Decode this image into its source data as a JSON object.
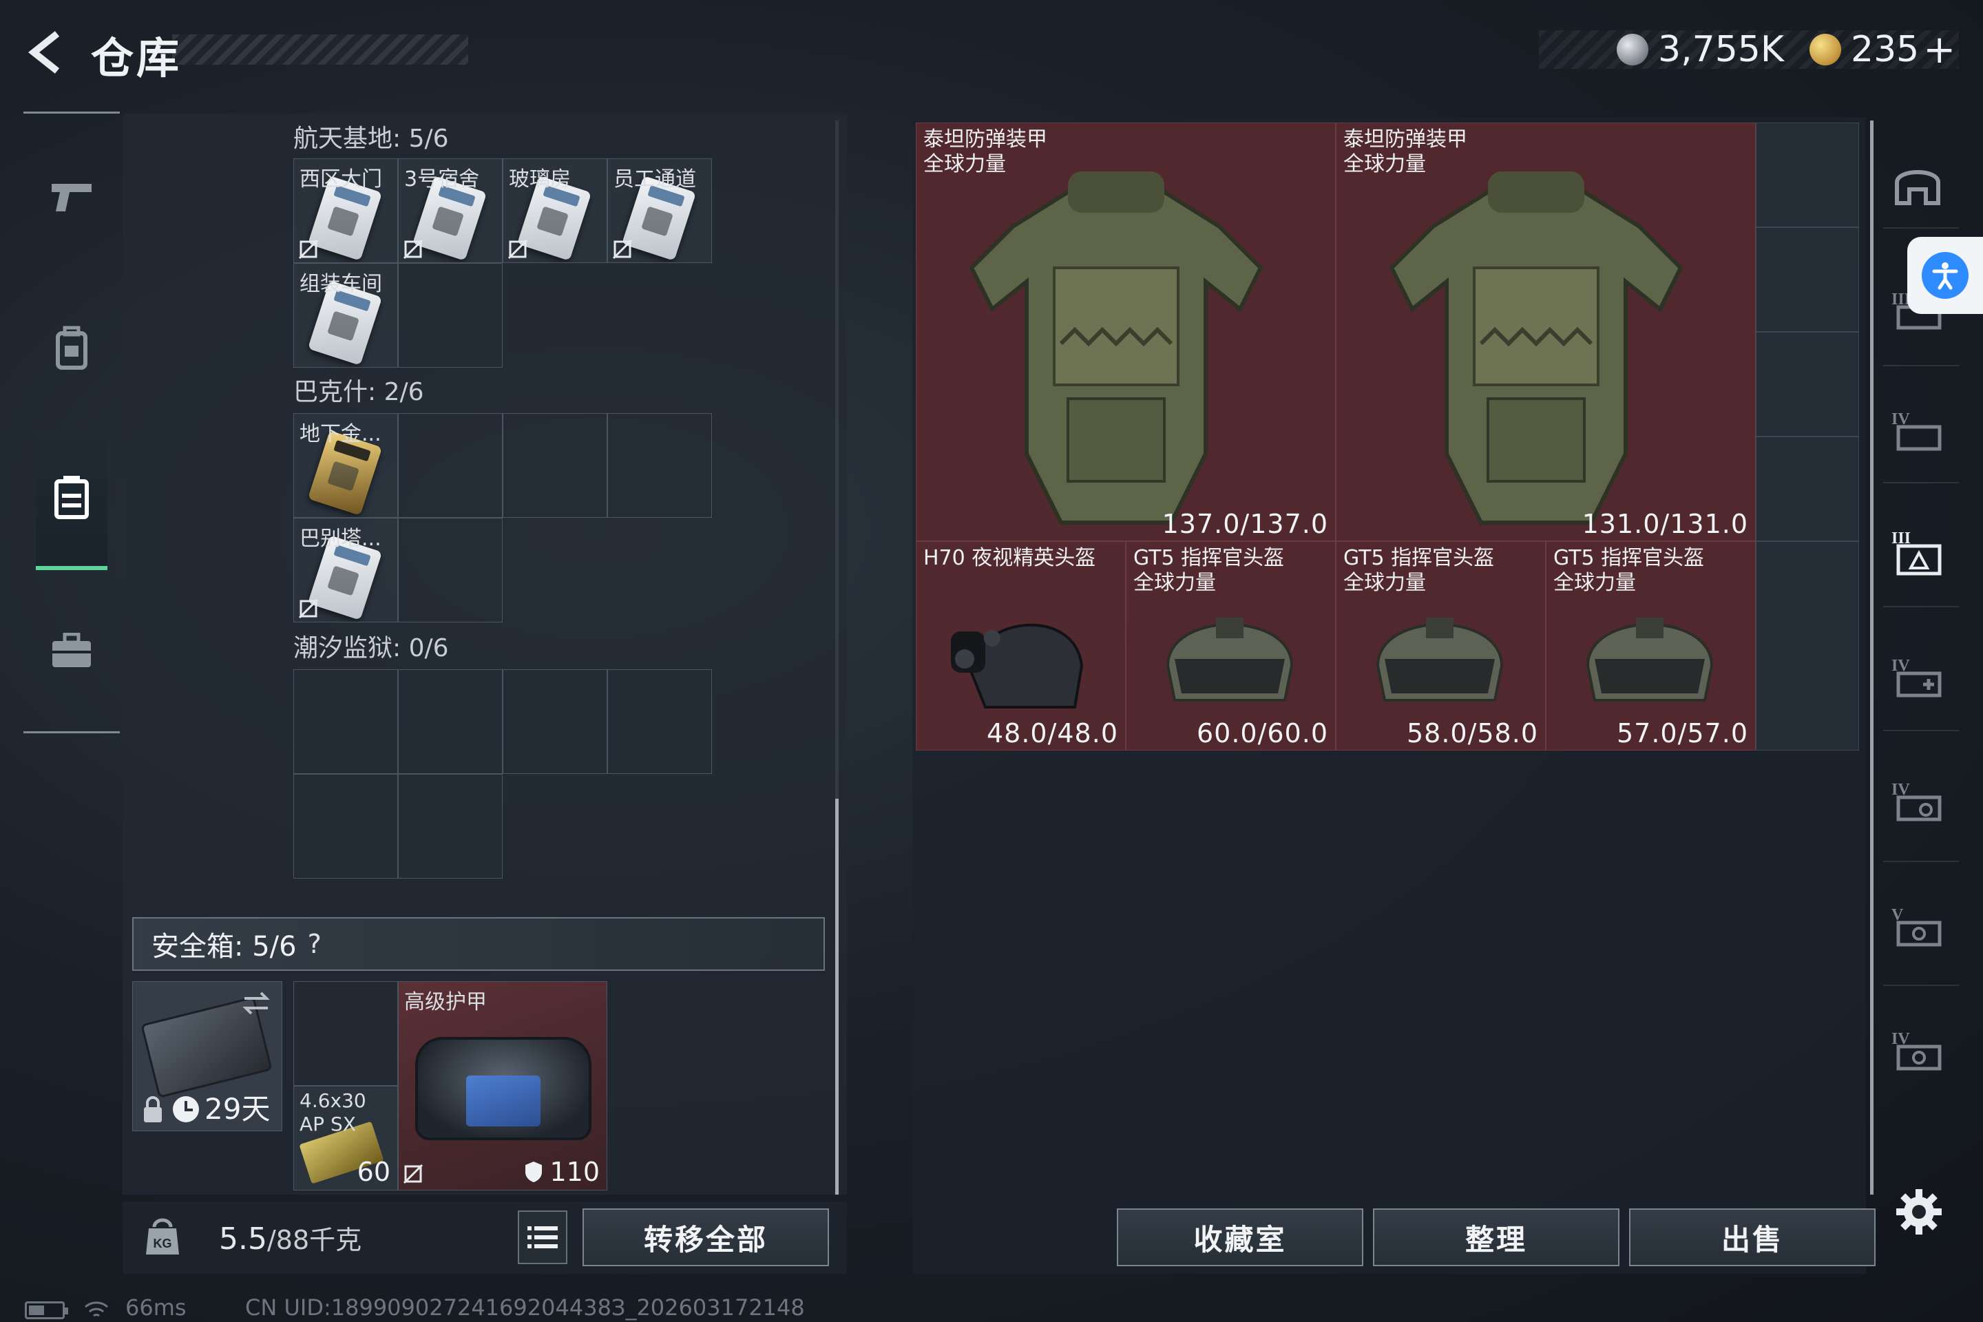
{
  "header": {
    "title": "仓库",
    "currency1": "3,755K",
    "currency2": "235",
    "currency2_suffix": "+"
  },
  "sections": [
    {
      "label": "航天基地: 5/6",
      "items": [
        "西区大门",
        "3号宿舍",
        "玻璃房",
        "员工通道",
        "组装车间"
      ]
    },
    {
      "label": "巴克什: 2/6",
      "items": [
        "地下金...",
        "巴别塔..."
      ]
    },
    {
      "label": "潮汐监狱: 0/6",
      "items": []
    }
  ],
  "safebox": {
    "label": "安全箱: 5/6",
    "help": "?",
    "case_days": "29天",
    "ammo_label": "4.6x30 AP SX",
    "ammo_count": "60",
    "bag_label": "高级护甲",
    "bag_value": "110"
  },
  "weight": {
    "current": "5.5",
    "max": "/88千克"
  },
  "buttons": {
    "transfer_all": "转移全部",
    "collection": "收藏室",
    "organize": "整理",
    "sell": "出售"
  },
  "items": [
    {
      "name": "泰坦防弹装甲",
      "sub": "全球力量",
      "durability": "137.0/137.0"
    },
    {
      "name": "泰坦防弹装甲",
      "sub": "全球力量",
      "durability": "131.0/131.0"
    },
    {
      "name": "H70 夜视精英头盔",
      "sub": "",
      "durability": "48.0/48.0"
    },
    {
      "name": "GT5 指挥官头盔",
      "sub": "全球力量",
      "durability": "60.0/60.0"
    },
    {
      "name": "GT5 指挥官头盔",
      "sub": "全球力量",
      "durability": "58.0/58.0"
    },
    {
      "name": "GT5 指挥官头盔",
      "sub": "全球力量",
      "durability": "57.0/57.0"
    }
  ],
  "right_nav_tiers": [
    "",
    "III",
    "IV",
    "III",
    "IV",
    "IV",
    "V",
    "IV"
  ],
  "status": {
    "ping": "66ms",
    "uid": "CN UID:18990902724169204438З_202603172148"
  },
  "colors": {
    "item_bg": "#602a30",
    "active_tab": "#5fd49a",
    "accessibility": "#2f8cff"
  }
}
